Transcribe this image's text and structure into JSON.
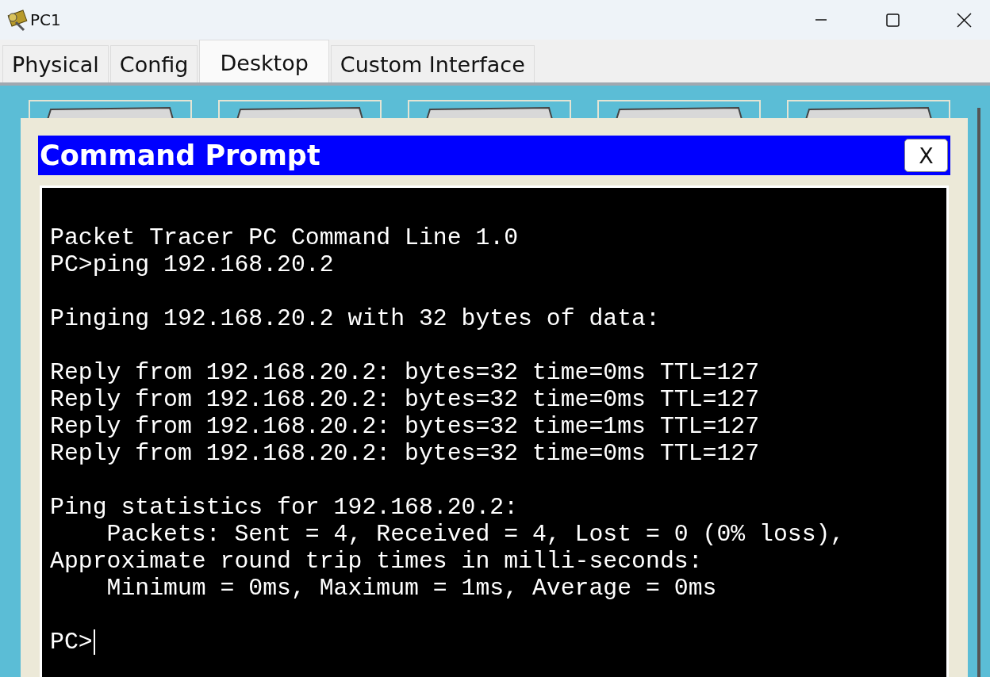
{
  "window": {
    "title": "PC1"
  },
  "tabs": [
    {
      "label": "Physical",
      "selected": false
    },
    {
      "label": "Config",
      "selected": false
    },
    {
      "label": "Desktop",
      "selected": true
    },
    {
      "label": "Custom Interface",
      "selected": false
    }
  ],
  "command_prompt": {
    "title": "Command Prompt",
    "close_label": "X",
    "blocks": [
      [
        "Packet Tracer PC Command Line 1.0",
        "PC>ping 192.168.20.2"
      ],
      [
        "Pinging 192.168.20.2 with 32 bytes of data:"
      ],
      [
        "Reply from 192.168.20.2: bytes=32 time=0ms TTL=127",
        "Reply from 192.168.20.2: bytes=32 time=0ms TTL=127",
        "Reply from 192.168.20.2: bytes=32 time=1ms TTL=127",
        "Reply from 192.168.20.2: bytes=32 time=0ms TTL=127"
      ],
      [
        "Ping statistics for 192.168.20.2:",
        "    Packets: Sent = 4, Received = 4, Lost = 0 (0% loss),",
        "Approximate round trip times in milli-seconds:",
        "    Minimum = 0ms, Maximum = 1ms, Average = 0ms"
      ],
      [
        "PC>"
      ]
    ]
  }
}
